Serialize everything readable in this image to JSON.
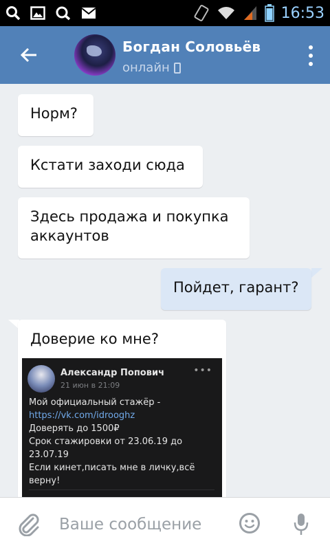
{
  "status_bar": {
    "time": "16:53",
    "left_icons": [
      "search-icon",
      "image-icon",
      "search-alt-icon",
      "mail-icon"
    ],
    "right_icons": [
      "vibrate-icon",
      "wifi-icon",
      "signal-icon",
      "battery-icon"
    ]
  },
  "header": {
    "contact_name": "Богдан Соловьёв",
    "status": "онлайн",
    "colors": {
      "bar": "#5181b8"
    }
  },
  "messages": [
    {
      "direction": "incoming",
      "text": "Норм?"
    },
    {
      "direction": "incoming",
      "text": "Кстати заходи сюда"
    },
    {
      "direction": "incoming",
      "text": "Здесь продажа и покупка аккаунтов"
    },
    {
      "direction": "outgoing",
      "text": "Пойдет, гарант?"
    },
    {
      "direction": "incoming",
      "text": "Доверие ко мне?",
      "attachment": {
        "author": "Александр Попович",
        "date": "21 июн в 21:09",
        "more": "•••",
        "line1_prefix": "Мой официальный стажёр - ",
        "line1_link": "https://vk.com/idrooghz",
        "line2": "Доверять до 1500₽",
        "line3": "Срок стажировки от 23.06.19 до 23.07.19",
        "line4": "Если кинет,писать мне в личку,всё верну!"
      }
    }
  ],
  "input": {
    "placeholder": "Ваше сообщение"
  }
}
